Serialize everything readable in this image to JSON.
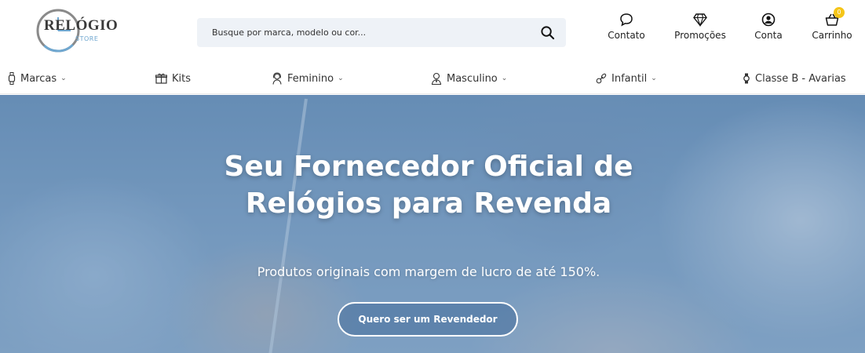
{
  "logo": {
    "title": "RELÓGIO",
    "subtitle": "STORE"
  },
  "search": {
    "placeholder": "Busque por marca, modelo ou cor..."
  },
  "header_actions": {
    "contato": {
      "label": "Contato",
      "icon": "chat-bubble-icon"
    },
    "promocoes": {
      "label": "Promoções",
      "icon": "diamond-icon"
    },
    "conta": {
      "label": "Conta",
      "icon": "user-circle-icon"
    },
    "carrinho": {
      "label": "Carrinho",
      "icon": "basket-icon",
      "count": "0"
    }
  },
  "nav": {
    "items": [
      {
        "label": "Marcas",
        "icon": "watch-icon",
        "has_dropdown": true
      },
      {
        "label": "Kits",
        "icon": "gift-box-icon",
        "has_dropdown": false
      },
      {
        "label": "Feminino",
        "icon": "woman-icon",
        "has_dropdown": true
      },
      {
        "label": "Masculino",
        "icon": "man-icon",
        "has_dropdown": true
      },
      {
        "label": "Infantil",
        "icon": "pacifier-icon",
        "has_dropdown": true
      },
      {
        "label": "Classe B - Avarias",
        "icon": "watch-icon",
        "has_dropdown": false
      }
    ]
  },
  "hero": {
    "title": "Seu Fornecedor Oficial de Relógios para Revenda",
    "subtitle": "Produtos originais com margem de lucro de até 150%.",
    "cta": "Quero ser um Revendedor"
  },
  "colors": {
    "badge": "#f5c518",
    "search_bg": "#eef2f7",
    "hero_tint": "#5c84b2"
  }
}
